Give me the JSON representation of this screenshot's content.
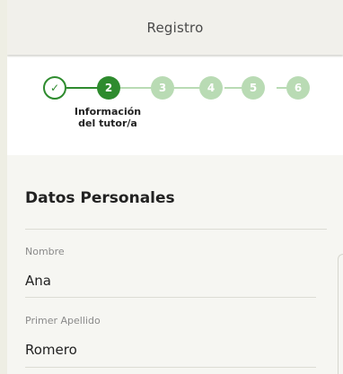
{
  "header": {
    "title": "Registro"
  },
  "stepper": {
    "steps": [
      {
        "label": "✓",
        "state": "done"
      },
      {
        "label": "2",
        "state": "active"
      },
      {
        "label": "3",
        "state": "pending"
      },
      {
        "label": "4",
        "state": "pending"
      },
      {
        "label": "5",
        "state": "pending"
      },
      {
        "label": "6",
        "state": "pending"
      }
    ],
    "active_label_line1": "Información",
    "active_label_line2": "del tutor/a"
  },
  "section": {
    "title": "Datos Personales",
    "fields": [
      {
        "label": "Nombre",
        "value": "Ana"
      },
      {
        "label": "Primer Apellido",
        "value": "Romero"
      }
    ]
  },
  "colors": {
    "accent": "#2e8b2e",
    "pending": "#b9dbb4"
  }
}
